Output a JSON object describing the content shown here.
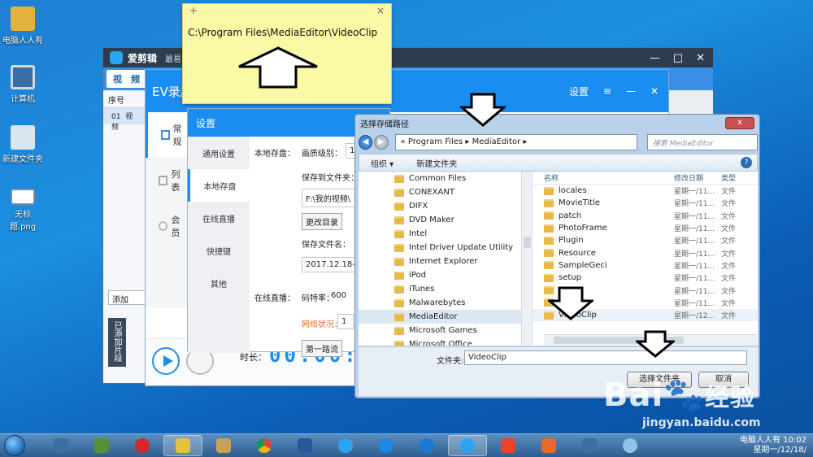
{
  "desktop_icons": [
    {
      "label": "电脑人人有",
      "icon": "folder-user-icon"
    },
    {
      "label": "计算机",
      "icon": "computer-icon"
    },
    {
      "label": "新建文件夹",
      "icon": "tiger-folder-icon"
    },
    {
      "label": "无标题.png",
      "icon": "image-file-icon"
    }
  ],
  "app": {
    "title": "爱剪辑",
    "subtitle": "最易",
    "tab_video": "视　频",
    "list_header": "序号",
    "list_row_num": "01",
    "list_row_name": "视频",
    "add_button": "添加",
    "added_clips": "已添加片段"
  },
  "ev": {
    "title": "EV录屏",
    "settings": "设置",
    "side_items": [
      "常规",
      "列表",
      "会员"
    ],
    "time_label": "时长：",
    "time_value": "00:00:"
  },
  "settings": {
    "title": "设置",
    "side_items": [
      "通用设置",
      "本地存盘",
      "在线直播",
      "快捷键",
      "其他"
    ],
    "local_label": "本地存盘：",
    "quality_label": "画质级别：",
    "quality_value": "1",
    "save_folder_label": "保存到文件夹：",
    "save_folder_value": "F:\\我的视频\\",
    "change_dir": "更改目录",
    "save_name_label": "保存文件名：",
    "save_name_value": "2017.12.18-0",
    "live_label": "在线直播：",
    "bitrate_label": "码特率：",
    "bitrate_value": "600",
    "network_label": "网络状况：",
    "network_value": "1",
    "stream_button": "第一路流"
  },
  "note": {
    "plus": "+",
    "close": "×",
    "text": "C:\\Program Files\\MediaEditor\\VideoClip"
  },
  "file_dialog": {
    "title": "选择存储路径",
    "close": "x",
    "address": [
      "«",
      "Program Files",
      "MediaEditor"
    ],
    "search_placeholder": "搜索 MediaEditor",
    "organize": "组织 ▾",
    "new_folder": "新建文件夹",
    "help": "?",
    "left_folders": [
      "Common Files",
      "CONEXANT",
      "DIFX",
      "DVD Maker",
      "Intel",
      "Intel Driver Update Utility",
      "Internet Explorer",
      "iPod",
      "iTunes",
      "Malwarebytes",
      "MediaEditor",
      "Microsoft Games",
      "Microsoft Office"
    ],
    "left_selected": 10,
    "col_name": "名称",
    "col_date": "修改日期",
    "col_type": "类型",
    "right_rows": [
      {
        "name": "locales",
        "date": "星期一/11...",
        "type": "文件"
      },
      {
        "name": "MovieTitle",
        "date": "星期一/11...",
        "type": "文件"
      },
      {
        "name": "patch",
        "date": "星期一/11...",
        "type": "文件"
      },
      {
        "name": "PhotoFrame",
        "date": "星期一/11...",
        "type": "文件"
      },
      {
        "name": "Plugin",
        "date": "星期一/11...",
        "type": "文件"
      },
      {
        "name": "Resource",
        "date": "星期一/11...",
        "type": "文件"
      },
      {
        "name": "SampleGeci",
        "date": "星期一/11...",
        "type": "文件"
      },
      {
        "name": "setup",
        "date": "星期一/11...",
        "type": "文件"
      },
      {
        "name": "",
        "date": "星期一/11...",
        "type": "文件"
      },
      {
        "name": "update",
        "date": "星期一/11...",
        "type": "文件"
      },
      {
        "name": "VideoClip",
        "date": "星期一/12...",
        "type": "文件"
      }
    ],
    "right_selected": 10,
    "folder_label": "文件夹:",
    "folder_value": "VideoClip",
    "select_button": "选择文件夹",
    "cancel_button": "取消"
  },
  "watermark": {
    "main": "Bai",
    "cn": "经验",
    "url": "jingyan.baidu.com"
  },
  "tray": {
    "user": "电脑人人有 10:02",
    "date": "星期一/12/18/"
  }
}
